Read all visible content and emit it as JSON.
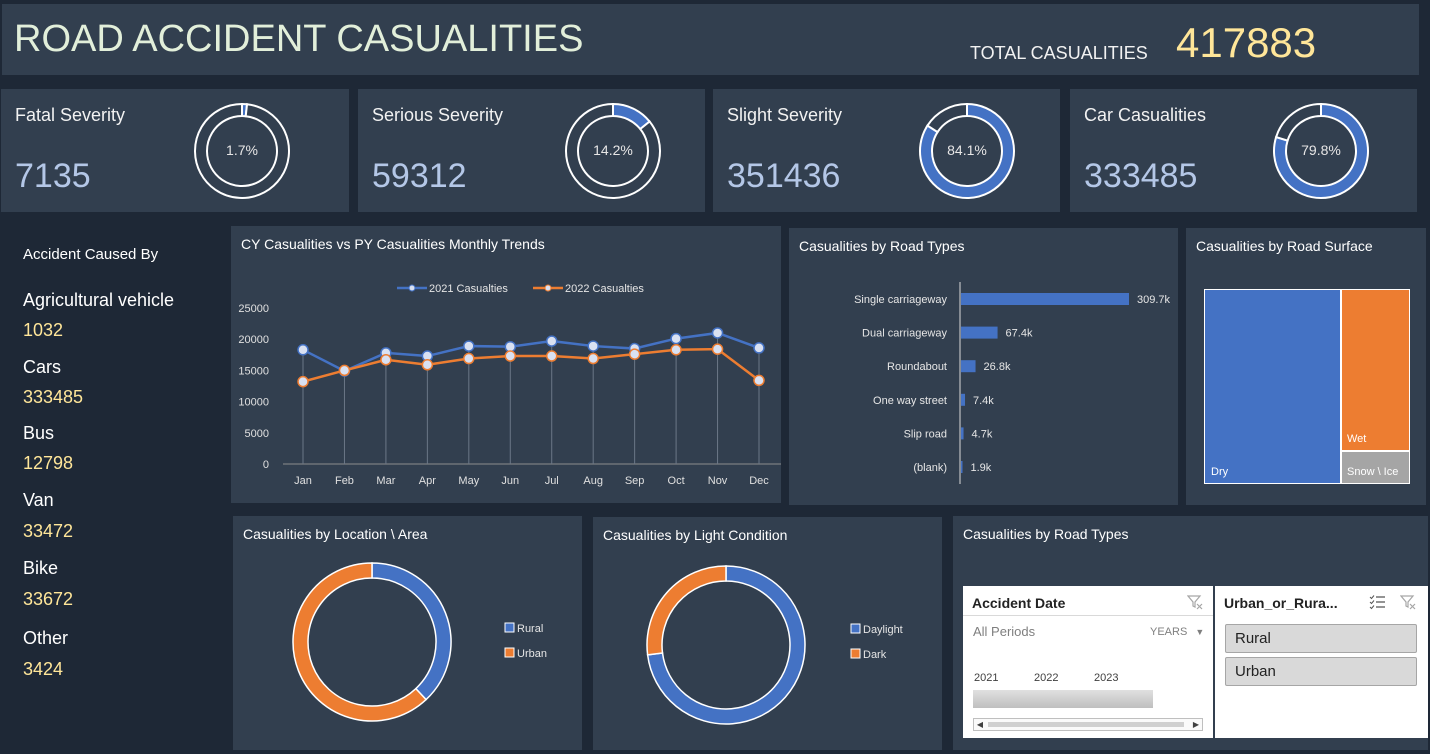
{
  "header": {
    "title": "ROAD ACCIDENT CASUALITIES",
    "total_label": "TOTAL CASUALITIES",
    "total_value": "417883"
  },
  "kpis": [
    {
      "title": "Fatal Severity",
      "value": "7135",
      "percent_label": "1.7%",
      "percent": 1.7
    },
    {
      "title": "Serious Severity",
      "value": "59312",
      "percent_label": "14.2%",
      "percent": 14.2
    },
    {
      "title": "Slight Severity",
      "value": "351436",
      "percent_label": "84.1%",
      "percent": 84.1
    },
    {
      "title": "Car Casualities",
      "value": "333485",
      "percent_label": "79.8%",
      "percent": 79.8
    }
  ],
  "colors": {
    "blue": "#4472c4",
    "orange": "#ed7d31",
    "grey": "#a5a5a5",
    "gold": "#ffe699",
    "kpi_value": "#b4c7e7"
  },
  "sidebar": {
    "title": "Accident Caused By",
    "items": [
      {
        "label": "Agricultural vehicle",
        "value": "1032"
      },
      {
        "label": "Cars",
        "value": "333485"
      },
      {
        "label": "Bus",
        "value": "12798"
      },
      {
        "label": "Van",
        "value": "33472"
      },
      {
        "label": "Bike",
        "value": "33672"
      },
      {
        "label": "Other",
        "value": "3424"
      }
    ]
  },
  "panels": {
    "trend_title": "CY Casualities vs PY Casualities Monthly Trends",
    "road_types_title": "Casualities by Road Types",
    "surface_title": "Casualities by Road Surface",
    "location_title": "Casualities by Location \\ Area",
    "light_title": "Casualities by Light Condition",
    "road_types2_title": "Casualities by Road Types"
  },
  "chart_data": [
    {
      "type": "line",
      "title": "CY Casualities vs PY Casualities Monthly Trends",
      "categories": [
        "Jan",
        "Feb",
        "Mar",
        "Apr",
        "May",
        "Jun",
        "Jul",
        "Aug",
        "Sep",
        "Oct",
        "Nov",
        "Dec"
      ],
      "ylim": [
        0,
        25000
      ],
      "yticks": [
        0,
        5000,
        10000,
        15000,
        20000,
        25000
      ],
      "legend_position": "top",
      "series": [
        {
          "name": "2021 Casualties",
          "color": "#4472c4",
          "values": [
            18300,
            14900,
            17800,
            17300,
            18900,
            18800,
            19700,
            18900,
            18500,
            20100,
            21000,
            18600
          ]
        },
        {
          "name": "2022 Casualties",
          "color": "#ed7d31",
          "values": [
            13200,
            15000,
            16700,
            15900,
            16900,
            17300,
            17300,
            16900,
            17600,
            18300,
            18400,
            13400
          ]
        }
      ]
    },
    {
      "type": "bar",
      "orientation": "horizontal",
      "title": "Casualities by Road Types",
      "categories": [
        "Single carriageway",
        "Dual carriageway",
        "Roundabout",
        "One way street",
        "Slip road",
        "(blank)"
      ],
      "values": [
        309700,
        67400,
        26800,
        7400,
        4700,
        1900
      ],
      "labels": [
        "309.7k",
        "67.4k",
        "26.8k",
        "7.4k",
        "4.7k",
        "1.9k"
      ]
    },
    {
      "type": "treemap",
      "title": "Casualities by Road Surface",
      "categories": [
        "Dry",
        "Wet",
        "Snow \\ Ice"
      ]
    },
    {
      "type": "pie",
      "title": "Casualities by Location \\ Area",
      "categories": [
        "Rural",
        "Urban"
      ],
      "values": [
        38,
        62
      ],
      "legend_position": "right"
    },
    {
      "type": "pie",
      "title": "Casualities by Light Condition",
      "categories": [
        "Daylight",
        "Dark"
      ],
      "values": [
        73,
        27
      ],
      "legend_position": "right"
    }
  ],
  "slicers": {
    "date": {
      "title": "Accident Date",
      "periods": "All Periods",
      "unit": "YEARS",
      "years": [
        "2021",
        "2022",
        "2023"
      ]
    },
    "area": {
      "title": "Urban_or_Rura...",
      "options": [
        "Rural",
        "Urban"
      ]
    }
  }
}
